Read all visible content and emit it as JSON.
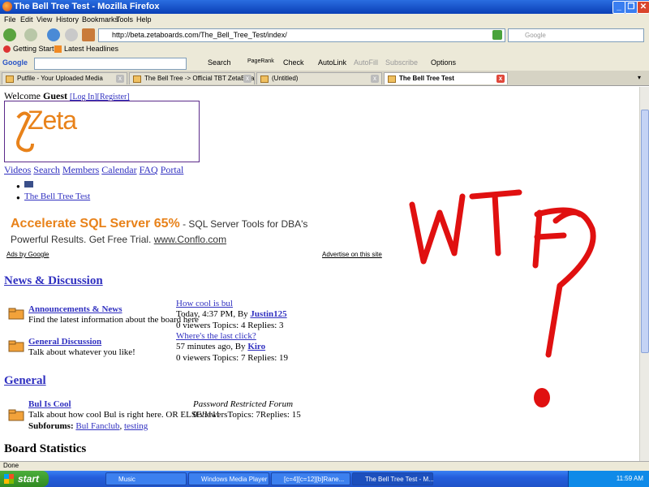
{
  "window": {
    "title": "The Bell Tree Test - Mozilla Firefox",
    "menu": [
      "File",
      "Edit",
      "View",
      "History",
      "Bookmarks",
      "Tools",
      "Help"
    ],
    "url": "http://beta.zetaboards.com/The_Bell_Tree_Test/index/",
    "search_placeholder": "Google",
    "bookmarks": [
      "Getting Started",
      "Latest Headlines"
    ],
    "google_toolbar": {
      "brand": "Google",
      "items": [
        "Search",
        "PageRank",
        "Check",
        "AutoLink",
        "AutoFill",
        "Subscribe",
        "Options"
      ]
    },
    "tabs": [
      {
        "label": "Putfile - Your Uploaded Media",
        "active": false
      },
      {
        "label": "The Bell Tree -> Official TBT ZetaBeta",
        "active": false
      },
      {
        "label": "(Untitled)",
        "active": false
      },
      {
        "label": "The Bell Tree Test",
        "active": true
      }
    ],
    "status": "Done"
  },
  "page": {
    "welcome_prefix": "Welcome",
    "welcome_user": "Guest",
    "login_link": "[Log In]",
    "register_link": "[Register]",
    "logo_text": "Zeta",
    "nav_links": [
      "Videos",
      "Search",
      "Members",
      "Calendar",
      "FAQ",
      "Portal"
    ],
    "breadcrumb": "The Bell Tree Test",
    "ad": {
      "headline": "Accelerate SQL Server 65%",
      "headline_tail": " - SQL Server Tools for DBA's",
      "line2": "Powerful Results. Get Free Trial.",
      "line2_link": "www.Conflo.com",
      "ads_by": "Ads by Google",
      "advertise": "Advertise on this site"
    },
    "categories": [
      {
        "title": "News & Discussion",
        "forums": [
          {
            "name": "Announcements & News",
            "desc": "Find the latest information about the board here",
            "last_topic": "How cool is bul",
            "last_post": "Today, 4:37 PM, By",
            "last_user": "Justin125",
            "stats": "0 viewers Topics: 4 Replies: 3"
          },
          {
            "name": "General Discussion",
            "desc": "Talk about whatever you like!",
            "last_topic": "Where's the last click?",
            "last_post": "57 minutes ago, By",
            "last_user": "Kiro",
            "stats": "0 viewers Topics: 7 Replies: 19"
          }
        ]
      },
      {
        "title": "General",
        "forums": [
          {
            "name": "Bul Is Cool",
            "desc": "Talk about how cool Bul is right here. OR ELSE!!11!",
            "restricted": "Password Restricted Forum",
            "stats": "0 viewersTopics: 7Replies: 15",
            "subforums_label": "Subforums:",
            "subforums": [
              "Bul Fanclub",
              "testing"
            ]
          }
        ]
      }
    ],
    "board_stats_title": "Board Statistics",
    "scribble": "WTF?"
  },
  "taskbar": {
    "start": "start",
    "buttons": [
      "Music",
      "Windows Media Player",
      "[c=4][c=12][b]Rane...",
      "The Bell Tree Test - M..."
    ],
    "clock": "11:59 AM"
  },
  "colors": {
    "link": "#3030c0",
    "scribble": "#e01010",
    "ad_orange": "#e8821a",
    "logo_orange": "#e8821a",
    "logo_border": "#5b2a8a"
  }
}
